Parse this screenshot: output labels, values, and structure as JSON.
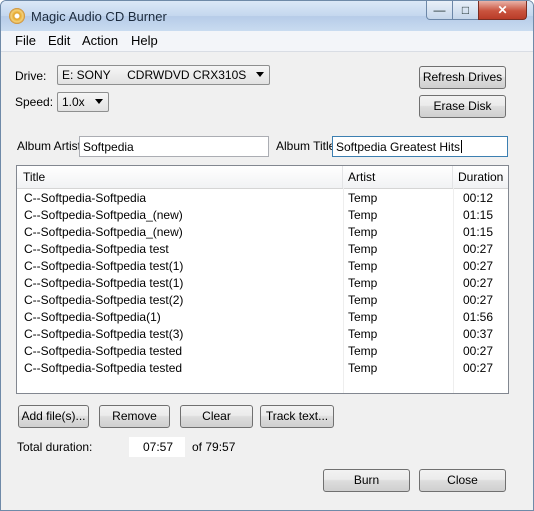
{
  "window": {
    "title": "Magic Audio CD Burner"
  },
  "titlebar_buttons": {
    "minimize": "—",
    "maximize": "□",
    "close": "✕"
  },
  "menu": [
    "File",
    "Edit",
    "Action",
    "Help"
  ],
  "drive": {
    "label": "Drive:",
    "value": "E: SONY     CDRWDVD CRX310S"
  },
  "speed": {
    "label": "Speed:",
    "value": "1.0x"
  },
  "buttons": {
    "refresh": "Refresh Drives",
    "erase": "Erase Disk",
    "add": "Add file(s)...",
    "remove": "Remove",
    "clear": "Clear",
    "track_text": "Track text...",
    "burn": "Burn",
    "close": "Close"
  },
  "album": {
    "artist_label": "Album Artist:",
    "artist_value": "Softpedia",
    "title_label": "Album Title:",
    "title_value": "Softpedia Greatest Hits"
  },
  "tracks": {
    "columns": [
      "Title",
      "Artist",
      "Duration"
    ],
    "rows": [
      [
        "C--Softpedia-Softpedia",
        "Temp",
        "00:12"
      ],
      [
        "C--Softpedia-Softpedia_(new)",
        "Temp",
        "01:15"
      ],
      [
        "C--Softpedia-Softpedia_(new)",
        "Temp",
        "01:15"
      ],
      [
        "C--Softpedia-Softpedia test",
        "Temp",
        "00:27"
      ],
      [
        "C--Softpedia-Softpedia test(1)",
        "Temp",
        "00:27"
      ],
      [
        "C--Softpedia-Softpedia test(1)",
        "Temp",
        "00:27"
      ],
      [
        "C--Softpedia-Softpedia test(2)",
        "Temp",
        "00:27"
      ],
      [
        "C--Softpedia-Softpedia(1)",
        "Temp",
        "01:56"
      ],
      [
        "C--Softpedia-Softpedia test(3)",
        "Temp",
        "00:37"
      ],
      [
        "C--Softpedia-Softpedia tested",
        "Temp",
        "00:27"
      ],
      [
        "C--Softpedia-Softpedia tested",
        "Temp",
        "00:27"
      ]
    ]
  },
  "total": {
    "label": "Total duration:",
    "value": "07:57",
    "of": "of 79:57"
  }
}
